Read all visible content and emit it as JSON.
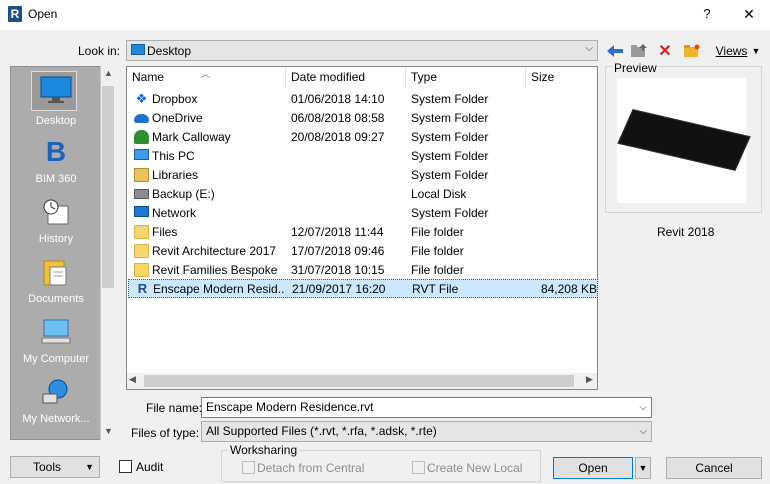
{
  "window": {
    "title": "Open",
    "help": "?",
    "close": "✕",
    "app_icon": "R"
  },
  "toolbar": {
    "lookin_label": "Look in:",
    "lookin_value": "Desktop",
    "views_label": "Views"
  },
  "places": [
    {
      "label": "Desktop",
      "icon": "desktop-icon"
    },
    {
      "label": "BIM 360",
      "icon": "bim360-icon"
    },
    {
      "label": "History",
      "icon": "history-icon"
    },
    {
      "label": "Documents",
      "icon": "documents-icon"
    },
    {
      "label": "My Computer",
      "icon": "computer-icon"
    },
    {
      "label": "My Network...",
      "icon": "network-icon"
    }
  ],
  "columns": {
    "name": "Name",
    "date": "Date modified",
    "type": "Type",
    "size": "Size"
  },
  "files": [
    {
      "name": "Dropbox",
      "date": "01/06/2018 14:10",
      "type": "System Folder",
      "size": "",
      "icon": "dropbox-icon"
    },
    {
      "name": "OneDrive",
      "date": "06/08/2018 08:58",
      "type": "System Folder",
      "size": "",
      "icon": "onedrive-icon"
    },
    {
      "name": "Mark Calloway",
      "date": "20/08/2018 09:27",
      "type": "System Folder",
      "size": "",
      "icon": "user-icon"
    },
    {
      "name": "This PC",
      "date": "",
      "type": "System Folder",
      "size": "",
      "icon": "pc-icon"
    },
    {
      "name": "Libraries",
      "date": "",
      "type": "System Folder",
      "size": "",
      "icon": "libraries-icon"
    },
    {
      "name": "Backup (E:)",
      "date": "",
      "type": "Local Disk",
      "size": "",
      "icon": "disk-icon"
    },
    {
      "name": "Network",
      "date": "",
      "type": "System Folder",
      "size": "",
      "icon": "network-icon"
    },
    {
      "name": "Files",
      "date": "12/07/2018 11:44",
      "type": "File folder",
      "size": "",
      "icon": "folder-icon"
    },
    {
      "name": "Revit Architecture 2017",
      "date": "17/07/2018 09:46",
      "type": "File folder",
      "size": "",
      "icon": "folder-icon"
    },
    {
      "name": "Revit Families Bespoke",
      "date": "31/07/2018 10:15",
      "type": "File folder",
      "size": "",
      "icon": "folder-icon"
    },
    {
      "name": "Enscape Modern Resid...",
      "date": "21/09/2017 16:20",
      "type": "RVT File",
      "size": "84,208 KB",
      "icon": "rvt-icon",
      "selected": true
    }
  ],
  "preview": {
    "label": "Preview",
    "caption": "Revit 2018"
  },
  "form": {
    "filename_label": "File name:",
    "filename_value": "Enscape Modern Residence.rvt",
    "filetype_label": "Files of type:",
    "filetype_value": "All Supported Files  (*.rvt, *.rfa, *.adsk, *.rte)"
  },
  "bottom": {
    "tools_label": "Tools",
    "audit_label": "Audit",
    "worksharing_label": "Worksharing",
    "detach_label": "Detach from Central",
    "create_label": "Create New Local",
    "open_label": "Open",
    "cancel_label": "Cancel"
  }
}
